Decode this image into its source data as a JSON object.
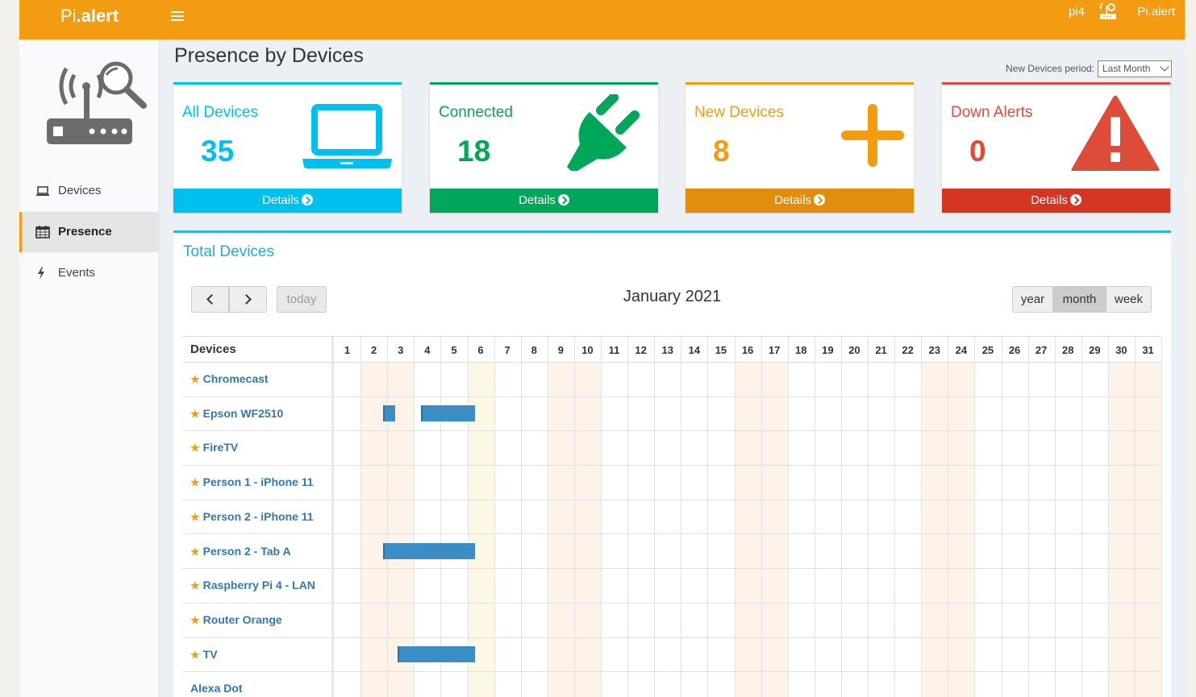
{
  "app": {
    "brand_prefix": "Pi",
    "brand_suffix": ".alert",
    "user": "pi4",
    "top_brand": "Pi.alert"
  },
  "sidebar": {
    "items": [
      {
        "label": "Devices",
        "icon": "laptop-icon"
      },
      {
        "label": "Presence",
        "icon": "calendar-icon",
        "active": true
      },
      {
        "label": "Events",
        "icon": "bolt-icon"
      }
    ]
  },
  "page": {
    "title": "Presence by Devices",
    "period_label": "New Devices period:",
    "period_value": "Last Month"
  },
  "tiles": [
    {
      "label": "All Devices",
      "value": "35",
      "footer": "Details",
      "color": "#00c0ef",
      "icon": "laptop-icon"
    },
    {
      "label": "Connected",
      "value": "18",
      "footer": "Details",
      "color": "#00a65a",
      "icon": "plug-icon"
    },
    {
      "label": "New Devices",
      "value": "8",
      "footer": "Details",
      "color": "#f39c12",
      "icon": "plus-icon"
    },
    {
      "label": "Down Alerts",
      "value": "0",
      "footer": "Details",
      "color": "#dd4b39",
      "icon": "warning-icon"
    }
  ],
  "calendar": {
    "title": "Total Devices",
    "month": "January 2021",
    "today_label": "today",
    "views": [
      "year",
      "month",
      "week"
    ],
    "active_view": "month",
    "devices_header": "Devices",
    "days": [
      "1",
      "2",
      "3",
      "4",
      "5",
      "6",
      "7",
      "8",
      "9",
      "10",
      "11",
      "12",
      "13",
      "14",
      "15",
      "16",
      "17",
      "18",
      "19",
      "20",
      "21",
      "22",
      "23",
      "24",
      "25",
      "26",
      "27",
      "28",
      "29",
      "30",
      "31"
    ],
    "weekend_days": [
      2,
      3,
      9,
      10,
      16,
      17,
      23,
      24,
      30,
      31
    ],
    "today_day": 6,
    "rows": [
      {
        "name": "Chromecast",
        "starred": true,
        "presence": []
      },
      {
        "name": "Epson WF2510",
        "starred": true,
        "presence": [
          [
            2.85,
            3.3
          ],
          [
            4.25,
            6.3
          ]
        ]
      },
      {
        "name": "FireTV",
        "starred": true,
        "presence": []
      },
      {
        "name": "Person 1 - iPhone 11",
        "starred": true,
        "presence": []
      },
      {
        "name": "Person 2 - iPhone 11",
        "starred": true,
        "presence": []
      },
      {
        "name": "Person 2 - Tab A",
        "starred": true,
        "presence": [
          [
            2.85,
            6.3
          ]
        ]
      },
      {
        "name": "Raspberry Pi 4 - LAN",
        "starred": true,
        "presence": []
      },
      {
        "name": "Router Orange",
        "starred": true,
        "presence": []
      },
      {
        "name": "TV",
        "starred": true,
        "presence": [
          [
            3.4,
            6.3
          ]
        ]
      },
      {
        "name": "Alexa Dot",
        "starred": false,
        "presence": []
      }
    ]
  }
}
